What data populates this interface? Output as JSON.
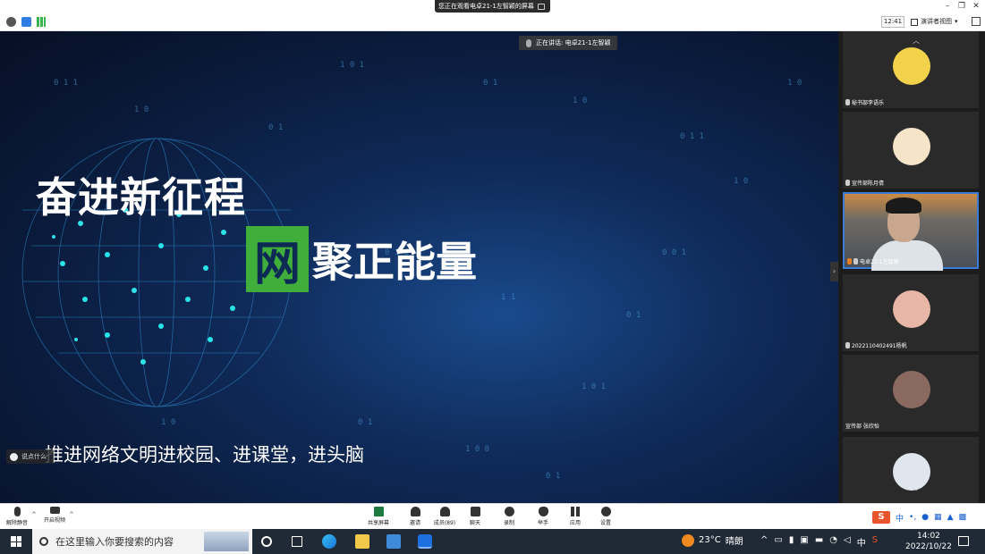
{
  "window": {
    "title": "您正在观看电卓21-1左智颖的屏幕"
  },
  "toolbar": {
    "time": "12:41",
    "view_label": "演讲者视图",
    "view_caret": "▾"
  },
  "stage": {
    "speaking_label": "正在讲话: 电卓21-1左智颖",
    "slide_title_line1": "奋进新征程",
    "slide_title_green": "网",
    "slide_title_rest": "聚正能量",
    "slide_subtitle": "推进网络文明进校园、进课堂，进头脑",
    "caption_label": "说点什么"
  },
  "participants": [
    {
      "name": "秘书部李语乐",
      "avatar_color": "#f2d24a"
    },
    {
      "name": "宣传部陈月倩",
      "avatar_color": "#f6e4c8"
    },
    {
      "name": "电卓21-1左智颖",
      "avatar_color": "#c9a78f"
    },
    {
      "name": "2022110402491杨帆",
      "avatar_color": "#e7b6a6"
    },
    {
      "name": "宣传部 张欣怡",
      "avatar_color": "#8a6a60"
    },
    {
      "name": "",
      "avatar_color": "#dfe6ee"
    }
  ],
  "bottom_toolbar": {
    "mute": "解除静音",
    "video": "开启视频",
    "share": "共享屏幕",
    "invite": "邀请",
    "members": "成员(89)",
    "chat": "聊天",
    "record": "录制",
    "raise_hand": "举手",
    "apps": "应用",
    "settings": "设置",
    "ime_s": "S",
    "ime_zh": "中"
  },
  "taskbar": {
    "search_placeholder": "在这里输入你要搜索的内容",
    "temperature": "23°C",
    "weather": "晴朗",
    "ime": "中",
    "time": "14:02",
    "date": "2022/10/22"
  },
  "colors": {
    "accent_green": "#3fae3a",
    "stage_blue": "#0f2b5a",
    "taskbar": "#1f2a36"
  }
}
